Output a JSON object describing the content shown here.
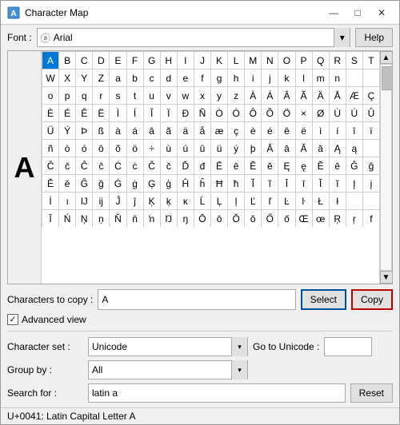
{
  "window": {
    "title": "Character Map",
    "icon": "character-map-icon"
  },
  "title_buttons": {
    "minimize": "—",
    "maximize": "□",
    "close": "✕"
  },
  "toolbar": {
    "font_label": "Font :",
    "font_value": "Arial",
    "font_icon": "Ⓐ",
    "help_label": "Help"
  },
  "char_grid": {
    "rows": [
      [
        "A",
        "B",
        "C",
        "D",
        "E",
        "F",
        "G",
        "H",
        "I",
        "J",
        "K",
        "L",
        "M",
        "N",
        "O",
        "P",
        "Q",
        "R",
        "S",
        "T"
      ],
      [
        "W",
        "X",
        "Y",
        "Z",
        "a",
        "b",
        "c",
        "d",
        "e",
        "f",
        "g",
        "h",
        "i",
        "j",
        "k",
        "l",
        "m",
        "n"
      ],
      [
        "o",
        "p",
        "q",
        "r",
        "s",
        "t",
        "u",
        "v",
        "w",
        "x",
        "y",
        "z",
        "À",
        "Á",
        "Â",
        "Ã",
        "Ä",
        "Å",
        "Æ",
        "Ç"
      ],
      [
        "È",
        "É",
        "Ê",
        "Ë",
        "Ì",
        "Í",
        "Î",
        "Ï",
        "Ð",
        "Ñ",
        "Ò",
        "Ó",
        "Ô",
        "Õ",
        "Ö",
        "×",
        "Ø",
        "Ù",
        "Ú",
        "Û"
      ],
      [
        "Ü",
        "Ý",
        "Þ",
        "ß",
        "à",
        "á",
        "â",
        "ã",
        "ä",
        "å",
        "æ",
        "ç",
        "è",
        "é",
        "ê",
        "ë",
        "ì",
        "í",
        "î",
        "ï"
      ],
      [
        "ñ",
        "ò",
        "ó",
        "ô",
        "õ",
        "ö",
        "÷",
        "ù",
        "ú",
        "û",
        "ü",
        "ý",
        "þ",
        "Ā",
        "ā",
        "Ă",
        "ă",
        "Ą",
        "ą"
      ],
      [
        "Č",
        "č",
        "Ĉ",
        "ĉ",
        "Ċ",
        "ċ",
        "Č",
        "č",
        "Ď",
        "đ",
        "Ē",
        "ē",
        "Ĕ",
        "ĕ",
        "Ę",
        "ę",
        "Ě",
        "ě",
        "Ĝ",
        "ĝ"
      ],
      [
        "Ě",
        "ě",
        "Ĝ",
        "ğ",
        "Ġ",
        "ġ",
        "Ģ",
        "ģ",
        "Ĥ",
        "ĥ",
        "Ħ",
        "ħ",
        "Ĩ",
        "ĩ",
        "Ī",
        "ī",
        "Ĭ",
        "ĭ",
        "Į",
        "į"
      ],
      [
        "İ",
        "ı",
        "Ĳ",
        "ĳ",
        "Ĵ",
        "ĵ",
        "Ķ",
        "ķ",
        "κ",
        "Ĺ",
        "Ļ",
        "ļ",
        "Ľ",
        "ľ",
        "Ŀ",
        "ŀ",
        "Ł",
        "ł"
      ],
      [
        "Ī",
        "Ń",
        "Ņ",
        "ņ",
        "Ň",
        "ň",
        "ŉ",
        "Ŋ",
        "ŋ",
        "Ō",
        "ō",
        "Ŏ",
        "ŏ",
        "Ő",
        "ő",
        "Œ",
        "œ",
        "Ŗ",
        "ŗ",
        "f"
      ]
    ],
    "selected_char": "A",
    "selected_index": 0
  },
  "bottom": {
    "chars_to_copy_label": "Characters to copy :",
    "chars_to_copy_value": "A",
    "select_label": "Select",
    "copy_label": "Copy",
    "advanced_view_label": "Advanced view",
    "advanced_checked": true,
    "character_set_label": "Character set :",
    "character_set_value": "Unicode",
    "go_to_unicode_label": "Go to Unicode :",
    "go_to_unicode_value": "",
    "group_by_label": "Group by :",
    "group_by_value": "All",
    "search_for_label": "Search for :",
    "search_for_value": "latin a",
    "reset_label": "Reset"
  },
  "status": {
    "text": "U+0041: Latin Capital Letter A"
  }
}
